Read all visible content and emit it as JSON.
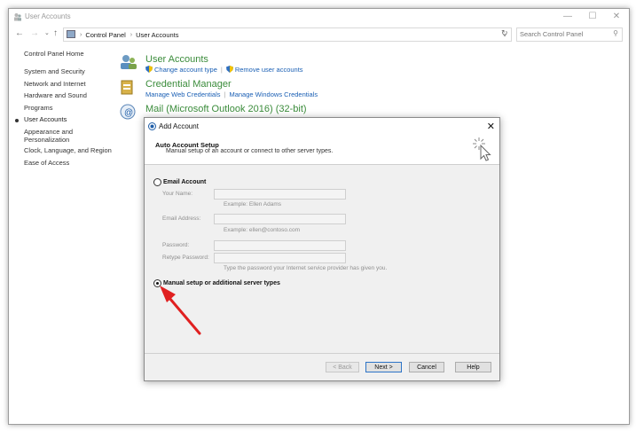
{
  "window": {
    "title": "User Accounts",
    "minimize": "—",
    "maximize": "☐",
    "close": "✕"
  },
  "address": {
    "back": "←",
    "forward": "→",
    "recent": "⌄",
    "up": "↑",
    "sep1": "›",
    "crumb1": "Control Panel",
    "sep2": "›",
    "crumb2": "User Accounts",
    "dropdown": "⌄",
    "refresh": "↻",
    "search_placeholder": "Search Control Panel",
    "search_icon": "⚲"
  },
  "sidebar": {
    "items": [
      {
        "label": "Control Panel Home"
      },
      {
        "label": "System and Security"
      },
      {
        "label": "Network and Internet"
      },
      {
        "label": "Hardware and Sound"
      },
      {
        "label": "Programs"
      },
      {
        "label": "User Accounts"
      },
      {
        "label": "Appearance and"
      },
      {
        "label": "Personalization"
      },
      {
        "label": "Clock, Language, and Region"
      },
      {
        "label": "Ease of Access"
      }
    ]
  },
  "main": {
    "user_accounts": {
      "title": "User Accounts",
      "link1": "Change account type",
      "link2": "Remove user accounts"
    },
    "credential_manager": {
      "title": "Credential Manager",
      "link1": "Manage Web Credentials",
      "link2": "Manage Windows Credentials"
    },
    "mail": {
      "title": "Mail (Microsoft Outlook 2016) (32-bit)"
    }
  },
  "dialog": {
    "title": "Add Account",
    "close": "✕",
    "header_title": "Auto Account Setup",
    "header_subtitle": "Manual setup of an account or connect to other server types.",
    "email_account_label": "Email Account",
    "your_name_label": "Your Name:",
    "your_name_hint": "Example: Ellen Adams",
    "email_address_label": "Email Address:",
    "email_address_hint": "Example: ellen@contoso.com",
    "password_label": "Password:",
    "retype_password_label": "Retype Password:",
    "password_hint": "Type the password your Internet service provider has given you.",
    "manual_setup_label": "Manual setup or additional server types",
    "back_button": "< Back",
    "next_button": "Next >",
    "cancel_button": "Cancel",
    "help_button": "Help"
  },
  "colors": {
    "link": "#1a5fb4",
    "section_title": "#3b8c3b",
    "annotation_arrow": "#e02020"
  }
}
